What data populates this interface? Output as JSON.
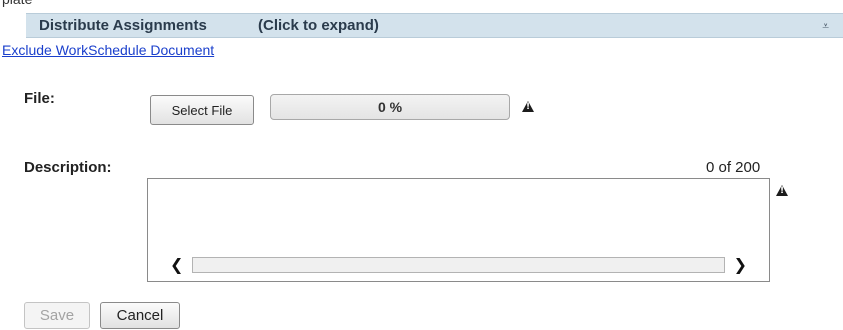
{
  "section": {
    "title": "Distribute Assignments",
    "hint": "(Click to expand)",
    "expand_icon": "expand-down-icon"
  },
  "exclude_link": "Exclude WorkSchedule Document",
  "file": {
    "label": "File:",
    "select_button": "Select File",
    "progress_text": "0 %",
    "progress_value": 0,
    "warning_icon": "warning-icon"
  },
  "description": {
    "label": "Description:",
    "counter": "0 of 200",
    "value": "",
    "warning_icon": "warning-icon",
    "scroll_left_icon": "chevron-left-icon",
    "scroll_right_icon": "chevron-right-icon"
  },
  "actions": {
    "save_label": "Save",
    "cancel_label": "Cancel"
  },
  "colors": {
    "header_bg": "#d3e2ec",
    "link": "#1a3fcc"
  }
}
